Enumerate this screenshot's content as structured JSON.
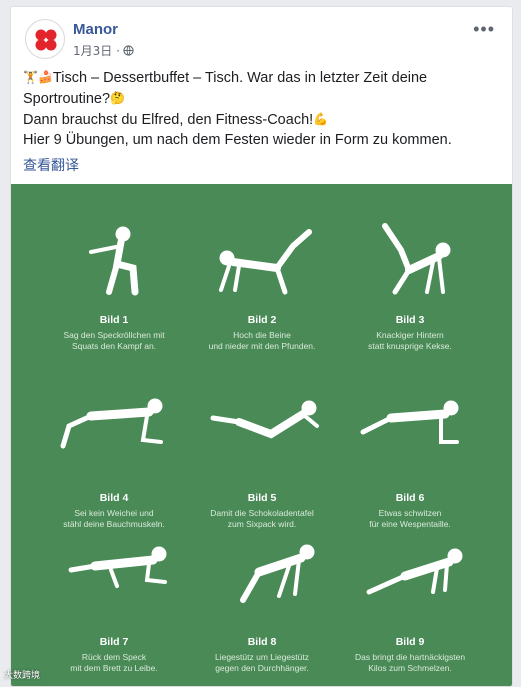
{
  "post": {
    "page_name": "Manor",
    "date": "1月3日 ·",
    "more_label": "•••",
    "text_line1": "Tisch – Dessertbuffet – Tisch. War das in letzter Zeit deine",
    "text_line2": "Sportroutine?",
    "text_line3": "Dann brauchst du Elfred, den Fitness-Coach!",
    "text_line4": "Hier 9 Übungen, um nach dem Festen wieder in Form zu kommen.",
    "translate_label": "查看翻译"
  },
  "exercises": [
    {
      "title": "Bild 1",
      "desc": "Sag den Speckröllchen mit\nSquats den Kampf an."
    },
    {
      "title": "Bild 2",
      "desc": "Hoch die Beine\nund nieder mit den Pfunden."
    },
    {
      "title": "Bild 3",
      "desc": "Knackiger Hintern\nstatt knusprige Kekse."
    },
    {
      "title": "Bild 4",
      "desc": "Sei kein Weichei und\nstähl deine Bauchmuskeln."
    },
    {
      "title": "Bild 5",
      "desc": "Damit die Schokoladentafel\nzum Sixpack wird."
    },
    {
      "title": "Bild 6",
      "desc": "Etwas schwitzen\nfür eine Wespentaille."
    },
    {
      "title": "Bild 7",
      "desc": "Rück dem Speck\nmit dem Brett zu Leibe."
    },
    {
      "title": "Bild 8",
      "desc": "Liegestütz um Liegestütz\ngegen den Durchhänger."
    },
    {
      "title": "Bild 9",
      "desc": "Das bringt die hartnäckigsten\nKilos zum Schmelzen."
    }
  ],
  "watermark": "大数跨境",
  "colors": {
    "link": "#385898",
    "image_bg": "#4a8a57",
    "logo_red": "#e3242b"
  },
  "icons": [
    "globe-icon",
    "more-icon",
    "manor-logo",
    "weightlifter-emoji",
    "cake-emoji",
    "thinking-emoji",
    "flexed-biceps-emoji"
  ]
}
